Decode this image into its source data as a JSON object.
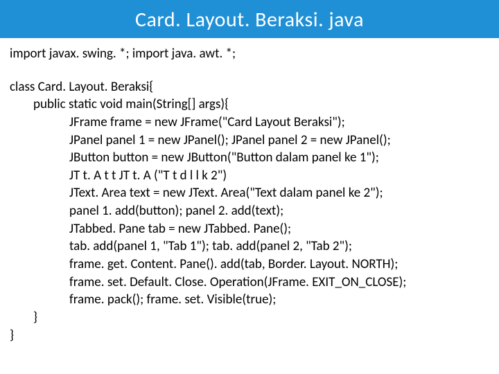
{
  "title": "Card. Layout. Beraksi. java",
  "lines": {
    "l0": "import javax. swing. *; import java. awt. *;",
    "l1": "class Card. Layout. Beraksi{",
    "l2": "public static void main(String[] args){",
    "l3": "JFrame frame = new JFrame(\"Card Layout Beraksi\");",
    "l4": "JPanel panel 1 = new JPanel(); JPanel panel 2 = new JPanel();",
    "l5": "JButton button = new JButton(\"Button dalam panel ke 1\");",
    "l6": "JT t. A t t JT t. A (\"T t d l l k 2\")",
    "l7": "JText. Area text = new JText. Area(\"Text dalam panel ke 2\");",
    "l8": "panel 1. add(button); panel 2. add(text);",
    "l9": "JTabbed. Pane tab = new JTabbed. Pane();",
    "l10": "tab. add(panel 1, \"Tab 1\"); tab. add(panel 2, \"Tab 2\");",
    "l11": "frame. get. Content. Pane(). add(tab, Border. Layout. NORTH);",
    "l12": "frame. set. Default. Close. Operation(JFrame. EXIT_ON_CLOSE);",
    "l13": "frame. pack(); frame. set. Visible(true);",
    "l14": "}",
    "l15": "}"
  }
}
